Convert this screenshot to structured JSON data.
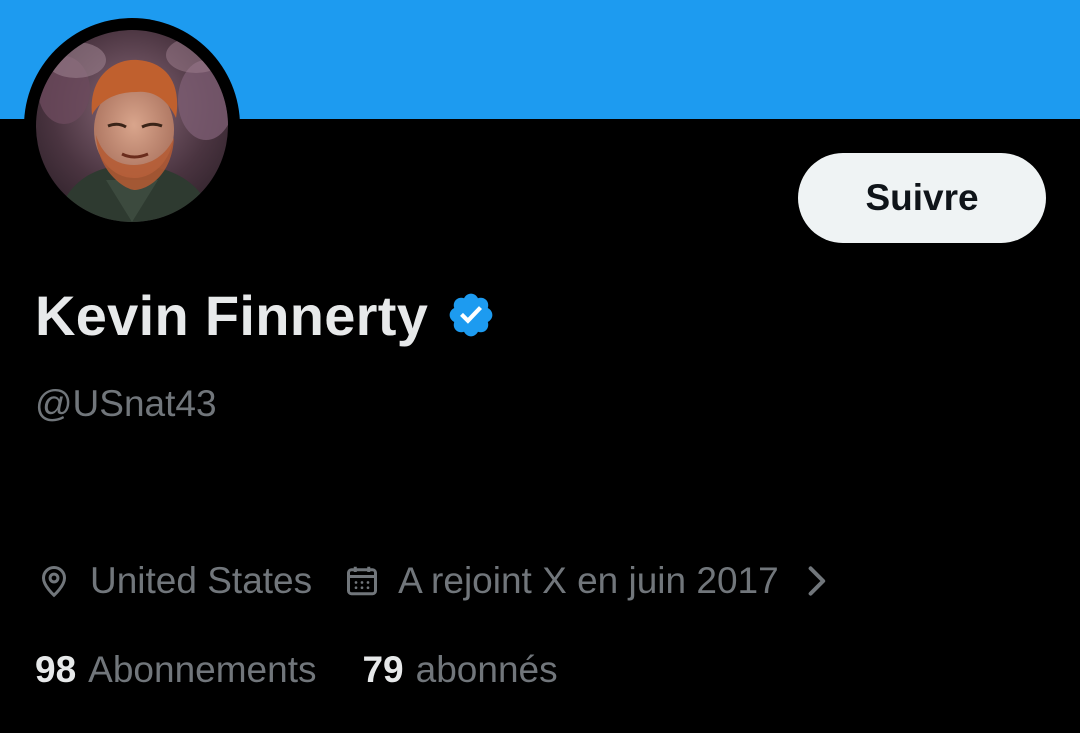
{
  "colors": {
    "banner": "#1D9BF0",
    "background": "#000000",
    "primary_text": "#E7E9EA",
    "secondary_text": "#71767B",
    "verified_badge": "#1D9BF0",
    "button_bg": "#EFF3F4",
    "button_text": "#0F1419"
  },
  "profile": {
    "display_name": "Kevin Finnerty",
    "handle": "@USnat43",
    "verified_icon": "verified-badge-icon",
    "avatar": "profile-photo"
  },
  "actions": {
    "follow_label": "Suivre"
  },
  "meta": {
    "location_icon": "location-pin-icon",
    "location": "United States",
    "joined_icon": "calendar-icon",
    "joined": "A rejoint X en juin 2017",
    "more_icon": "chevron-right-icon"
  },
  "stats": {
    "following_count": "98",
    "following_label": "Abonnements",
    "followers_count": "79",
    "followers_label": "abonnés"
  }
}
